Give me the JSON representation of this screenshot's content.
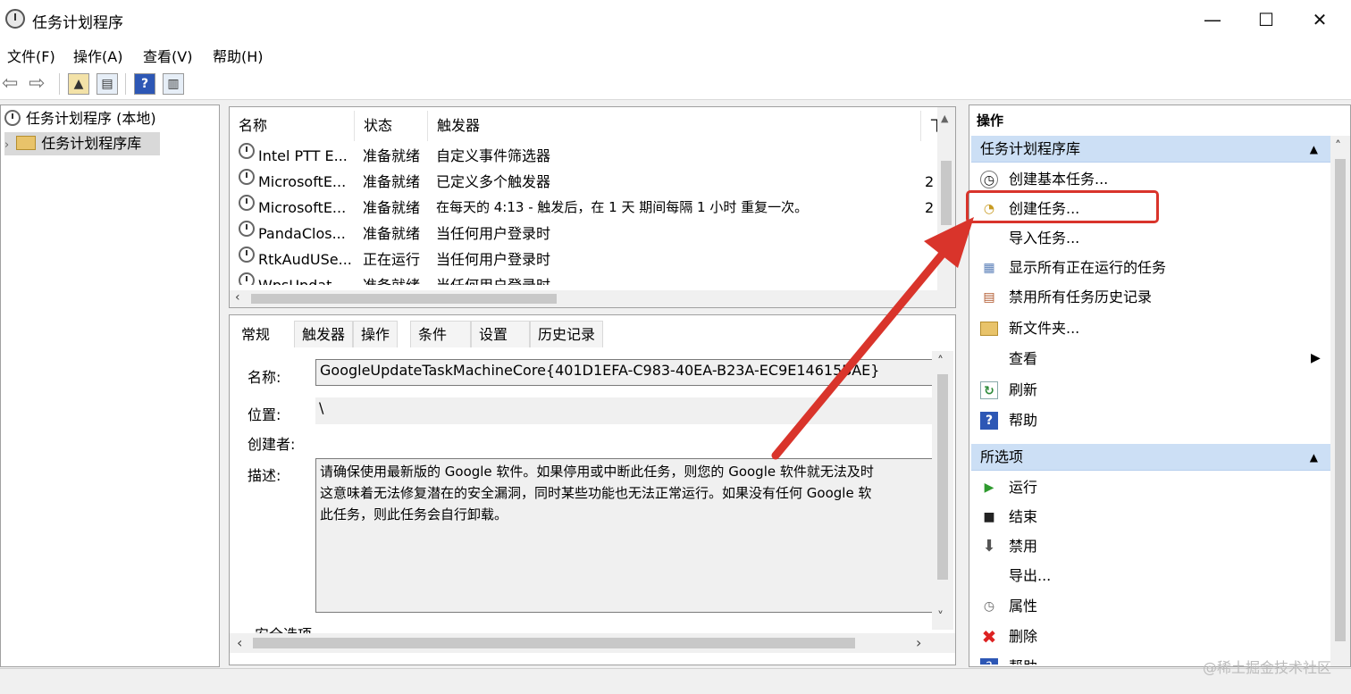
{
  "window": {
    "title": "任务计划程序",
    "min": "—",
    "max": "☐",
    "close": "✕"
  },
  "menu": [
    "文件(F)",
    "操作(A)",
    "查看(V)",
    "帮助(H)"
  ],
  "tree": {
    "root": "任务计划程序 (本地)",
    "library": "任务计划程序库"
  },
  "task_list": {
    "columns": [
      "名称",
      "状态",
      "触发器",
      "下"
    ],
    "rows": [
      {
        "name": "Intel PTT E...",
        "status": "准备就绪",
        "trigger": "自定义事件筛选器",
        "extra": ""
      },
      {
        "name": "MicrosoftE...",
        "status": "准备就绪",
        "trigger": "已定义多个触发器",
        "extra": "2"
      },
      {
        "name": "MicrosoftE...",
        "status": "准备就绪",
        "trigger": "在每天的 4:13 - 触发后，在 1 天 期间每隔 1 小时 重复一次。",
        "extra": "2"
      },
      {
        "name": "PandaClos...",
        "status": "准备就绪",
        "trigger": "当任何用户登录时",
        "extra": ""
      },
      {
        "name": "RtkAudUSe...",
        "status": "正在运行",
        "trigger": "当任何用户登录时",
        "extra": ""
      },
      {
        "name": "WpsUpdat...",
        "status": "准备就绪",
        "trigger": "当任何用户登录时",
        "extra": ""
      }
    ]
  },
  "details": {
    "tabs": [
      "常规",
      "触发器",
      "操作",
      "条件",
      "设置",
      "历史记录"
    ],
    "name_label": "名称:",
    "name_value": "GoogleUpdateTaskMachineCore{401D1EFA-C983-40EA-B23A-EC9E14615BAE}",
    "location_label": "位置:",
    "location_value": "\\",
    "author_label": "创建者:",
    "desc_label": "描述:",
    "desc_lines": [
      "请确保使用最新版的 Google 软件。如果停用或中断此任务，则您的 Google 软件就无法及时",
      "这意味着无法修复潜在的安全漏洞，同时某些功能也无法正常运行。如果没有任何 Google 软",
      "此任务，则此任务会自行卸载。"
    ],
    "security_label": "安全选项"
  },
  "actions": {
    "header": "操作",
    "library_section": "任务计划程序库",
    "library_items": [
      {
        "label": "创建基本任务...",
        "icon": "basic-task-icon"
      },
      {
        "label": "创建任务...",
        "icon": "create-task-icon"
      },
      {
        "label": "导入任务...",
        "icon": ""
      },
      {
        "label": "显示所有正在运行的任务",
        "icon": "running-tasks-icon"
      },
      {
        "label": "禁用所有任务历史记录",
        "icon": "history-icon"
      },
      {
        "label": "新文件夹...",
        "icon": "folder-icon"
      },
      {
        "label": "查看",
        "icon": ""
      },
      {
        "label": "刷新",
        "icon": "refresh-icon"
      },
      {
        "label": "帮助",
        "icon": "help-icon"
      }
    ],
    "selected_section": "所选项",
    "selected_items": [
      {
        "label": "运行",
        "icon": "run-icon"
      },
      {
        "label": "结束",
        "icon": "stop-icon"
      },
      {
        "label": "禁用",
        "icon": "disable-icon"
      },
      {
        "label": "导出...",
        "icon": ""
      },
      {
        "label": "属性",
        "icon": "properties-icon"
      },
      {
        "label": "删除",
        "icon": "delete-icon"
      },
      {
        "label": "帮助",
        "icon": "help-icon"
      }
    ]
  },
  "watermark": "@稀土掘金技术社区",
  "colors": {
    "accent": "#ccdff5",
    "highlight": "#d9342b"
  }
}
